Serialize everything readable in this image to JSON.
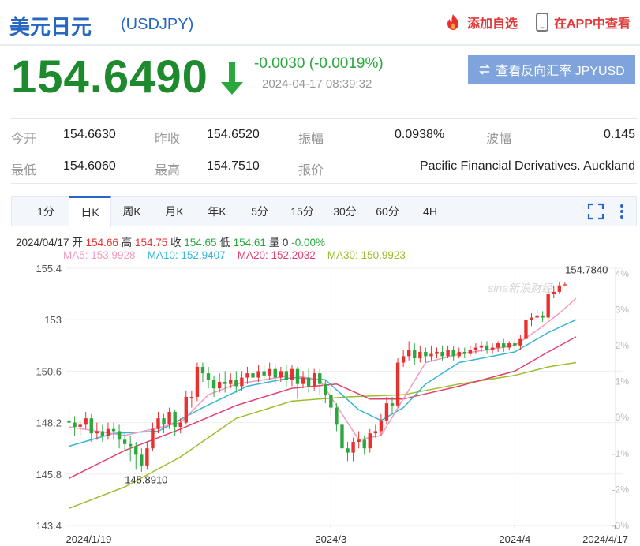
{
  "header": {
    "title": "美元日元",
    "code": "(USDJPY)",
    "add_fav": "添加自选",
    "app_view": "在APP中查看"
  },
  "quote": {
    "price": "154.6490",
    "change": "-0.0030 (-0.0019%)",
    "time": "2024-04-17 08:39:32",
    "reverse_button": "查看反向汇率 JPYUSD",
    "direction": "down"
  },
  "stats": {
    "open_label": "今开",
    "open": "154.6630",
    "prev_label": "昨收",
    "prev": "154.6520",
    "amp_label": "振幅",
    "amp": "0.0938%",
    "wave_label": "波幅",
    "wave": "0.145",
    "low_label": "最低",
    "low": "154.6060",
    "high_label": "最高",
    "high": "154.7510",
    "quoter_label": "报价",
    "quoter": "Pacific Financial Derivatives. Auckland"
  },
  "tabs": [
    "1分",
    "日K",
    "周K",
    "月K",
    "年K",
    "5分",
    "15分",
    "30分",
    "60分",
    "4H"
  ],
  "active_tab": "日K",
  "ohlc": {
    "date": "2024/04/17",
    "open_label": "开",
    "open": "154.66",
    "high_label": "高",
    "high": "154.75",
    "close_label": "收",
    "close": "154.65",
    "low_label": "低",
    "low": "154.61",
    "vol_label": "量",
    "vol": "0",
    "pct": "-0.00%"
  },
  "ma": {
    "ma5": "MA5: 153.9928",
    "ma10": "MA10: 152.9407",
    "ma20": "MA20: 152.2032",
    "ma30": "MA30: 150.9923"
  },
  "colors": {
    "up": "#e8312f",
    "down": "#2aa83e",
    "ma5": "#f49ac1",
    "ma10": "#35b6d4",
    "ma20": "#e3406f",
    "ma30": "#9bbd2a"
  },
  "chart_data": {
    "type": "candlestick",
    "ylim": [
      143.4,
      155.4
    ],
    "y_ticks": [
      "155.4",
      "153",
      "150.6",
      "148.2",
      "145.8",
      "143.4"
    ],
    "y_ticks_right": [
      "4%",
      "3%",
      "2%",
      "1%",
      "0%",
      "-1%",
      "-2%",
      "-3%"
    ],
    "x_ticks": [
      "2024/1/19",
      "2024/3",
      "2024/4",
      "2024/4/17"
    ],
    "x_tick_index": [
      0,
      47,
      80,
      98
    ],
    "annotations": [
      {
        "text": "154.7840",
        "index": 97,
        "value": 154.784
      },
      {
        "text": "145.8910",
        "index": 13,
        "value": 145.891
      }
    ],
    "watermark": "sina新浪财经",
    "candles": [
      [
        148.3,
        148.2,
        148.9,
        147.8
      ],
      [
        148.2,
        148.0,
        148.5,
        147.6
      ],
      [
        148.0,
        148.1,
        148.3,
        147.6
      ],
      [
        148.1,
        148.4,
        148.7,
        147.9
      ],
      [
        148.4,
        147.7,
        148.6,
        147.3
      ],
      [
        147.7,
        147.8,
        148.2,
        147.4
      ],
      [
        147.8,
        147.6,
        148.1,
        147.3
      ],
      [
        147.6,
        147.9,
        148.2,
        147.4
      ],
      [
        147.9,
        147.8,
        148.2,
        147.4
      ],
      [
        147.8,
        147.4,
        148.1,
        147.0
      ],
      [
        147.4,
        147.2,
        147.7,
        146.9
      ],
      [
        147.2,
        147.1,
        147.6,
        146.4
      ],
      [
        147.1,
        146.7,
        147.3,
        146.0
      ],
      [
        146.7,
        146.2,
        147.0,
        145.9
      ],
      [
        146.2,
        147.0,
        147.3,
        146.0
      ],
      [
        147.0,
        147.9,
        148.2,
        146.9
      ],
      [
        147.9,
        148.4,
        148.7,
        147.7
      ],
      [
        148.4,
        148.1,
        148.6,
        147.7
      ],
      [
        148.1,
        148.7,
        148.9,
        147.9
      ],
      [
        148.7,
        148.0,
        148.8,
        147.6
      ],
      [
        148.0,
        148.2,
        148.4,
        147.7
      ],
      [
        148.2,
        149.4,
        149.7,
        148.1
      ],
      [
        149.4,
        149.4,
        149.7,
        148.9
      ],
      [
        149.4,
        150.8,
        151.0,
        149.2
      ],
      [
        150.8,
        150.5,
        151.0,
        150.1
      ],
      [
        150.5,
        150.2,
        150.8,
        149.8
      ],
      [
        150.2,
        149.8,
        150.4,
        149.4
      ],
      [
        149.8,
        150.1,
        150.5,
        149.6
      ],
      [
        150.1,
        150.0,
        150.6,
        149.6
      ],
      [
        150.0,
        150.2,
        150.5,
        149.8
      ],
      [
        150.2,
        149.9,
        150.6,
        149.6
      ],
      [
        149.9,
        150.3,
        150.6,
        149.7
      ],
      [
        150.3,
        150.5,
        150.8,
        150.0
      ],
      [
        150.5,
        150.3,
        150.9,
        150.0
      ],
      [
        150.3,
        150.6,
        150.9,
        150.1
      ],
      [
        150.6,
        150.4,
        150.9,
        150.0
      ],
      [
        150.4,
        150.7,
        151.0,
        150.2
      ],
      [
        150.7,
        150.3,
        150.9,
        150.0
      ],
      [
        150.3,
        150.6,
        150.8,
        150.1
      ],
      [
        150.6,
        150.2,
        150.9,
        149.9
      ],
      [
        150.2,
        150.7,
        150.9,
        149.9
      ],
      [
        150.7,
        150.0,
        150.8,
        149.3
      ],
      [
        150.0,
        150.3,
        150.6,
        149.8
      ],
      [
        150.3,
        149.9,
        150.7,
        149.6
      ],
      [
        149.9,
        150.5,
        150.7,
        149.7
      ],
      [
        150.5,
        150.0,
        150.7,
        149.5
      ],
      [
        150.0,
        149.5,
        150.2,
        149.1
      ],
      [
        149.5,
        148.9,
        149.8,
        148.5
      ],
      [
        148.9,
        148.1,
        149.1,
        147.8
      ],
      [
        148.1,
        147.0,
        148.4,
        146.6
      ],
      [
        147.0,
        146.8,
        147.3,
        146.4
      ],
      [
        146.8,
        147.3,
        147.5,
        146.4
      ],
      [
        147.3,
        147.4,
        147.8,
        147.0
      ],
      [
        147.4,
        147.0,
        147.6,
        146.7
      ],
      [
        147.0,
        147.7,
        147.9,
        146.8
      ],
      [
        147.7,
        147.8,
        148.1,
        147.5
      ],
      [
        147.8,
        148.3,
        148.6,
        147.6
      ],
      [
        148.3,
        149.1,
        149.4,
        148.1
      ],
      [
        149.1,
        149.0,
        149.4,
        148.6
      ],
      [
        149.0,
        151.0,
        151.2,
        148.9
      ],
      [
        151.0,
        151.3,
        151.6,
        150.8
      ],
      [
        151.3,
        151.6,
        152.0,
        151.1
      ],
      [
        151.6,
        151.2,
        151.9,
        150.9
      ],
      [
        151.2,
        151.5,
        151.8,
        151.0
      ],
      [
        151.5,
        151.3,
        151.7,
        151.0
      ],
      [
        151.3,
        151.4,
        151.8,
        151.1
      ],
      [
        151.4,
        151.5,
        151.7,
        151.2
      ],
      [
        151.5,
        151.3,
        151.8,
        151.1
      ],
      [
        151.3,
        151.6,
        151.8,
        151.2
      ],
      [
        151.6,
        151.3,
        151.8,
        151.1
      ],
      [
        151.3,
        151.5,
        151.7,
        151.2
      ],
      [
        151.5,
        151.4,
        151.7,
        151.2
      ],
      [
        151.4,
        151.6,
        151.8,
        151.3
      ],
      [
        151.6,
        151.7,
        151.9,
        151.4
      ],
      [
        151.7,
        151.8,
        152.0,
        151.5
      ],
      [
        151.8,
        151.6,
        152.0,
        151.4
      ],
      [
        151.6,
        151.7,
        151.9,
        151.4
      ],
      [
        151.7,
        151.9,
        152.0,
        151.5
      ],
      [
        151.9,
        151.7,
        152.1,
        151.5
      ],
      [
        151.7,
        151.9,
        152.0,
        151.6
      ],
      [
        151.9,
        151.8,
        152.1,
        151.6
      ],
      [
        151.8,
        152.1,
        152.3,
        151.6
      ],
      [
        152.1,
        153.0,
        153.2,
        152.0
      ],
      [
        153.0,
        153.1,
        153.3,
        152.7
      ],
      [
        153.1,
        153.2,
        153.5,
        152.9
      ],
      [
        153.2,
        153.1,
        153.4,
        152.9
      ],
      [
        153.1,
        154.2,
        154.4,
        153.0
      ],
      [
        154.2,
        154.3,
        154.6,
        154.0
      ],
      [
        154.3,
        154.6,
        154.78,
        154.2
      ],
      [
        154.6,
        154.65,
        154.75,
        154.61
      ]
    ],
    "ma5": [
      [
        0,
        148.0
      ],
      [
        10,
        147.6
      ],
      [
        20,
        148.2
      ],
      [
        25,
        149.5
      ],
      [
        30,
        150.0
      ],
      [
        40,
        150.4
      ],
      [
        45,
        150.2
      ],
      [
        48,
        149.0
      ],
      [
        52,
        147.4
      ],
      [
        56,
        147.6
      ],
      [
        60,
        149.3
      ],
      [
        64,
        151.0
      ],
      [
        70,
        151.4
      ],
      [
        80,
        151.8
      ],
      [
        84,
        152.5
      ],
      [
        88,
        153.3
      ],
      [
        91,
        154.0
      ]
    ],
    "ma10": [
      [
        0,
        147.1
      ],
      [
        8,
        147.7
      ],
      [
        16,
        147.8
      ],
      [
        24,
        148.9
      ],
      [
        32,
        149.9
      ],
      [
        40,
        150.3
      ],
      [
        46,
        150.2
      ],
      [
        52,
        148.8
      ],
      [
        56,
        148.3
      ],
      [
        60,
        148.9
      ],
      [
        64,
        150.0
      ],
      [
        70,
        151.0
      ],
      [
        80,
        151.5
      ],
      [
        86,
        152.4
      ],
      [
        91,
        153.0
      ]
    ],
    "ma20": [
      [
        0,
        145.6
      ],
      [
        10,
        146.9
      ],
      [
        20,
        147.9
      ],
      [
        30,
        149.0
      ],
      [
        40,
        149.8
      ],
      [
        48,
        150.0
      ],
      [
        54,
        149.3
      ],
      [
        60,
        149.3
      ],
      [
        70,
        149.9
      ],
      [
        80,
        150.6
      ],
      [
        86,
        151.5
      ],
      [
        91,
        152.2
      ]
    ],
    "ma30": [
      [
        0,
        144.2
      ],
      [
        10,
        145.2
      ],
      [
        20,
        146.6
      ],
      [
        30,
        148.4
      ],
      [
        40,
        149.2
      ],
      [
        50,
        149.4
      ],
      [
        60,
        149.5
      ],
      [
        70,
        150.0
      ],
      [
        80,
        150.4
      ],
      [
        86,
        150.8
      ],
      [
        91,
        151.0
      ]
    ]
  }
}
